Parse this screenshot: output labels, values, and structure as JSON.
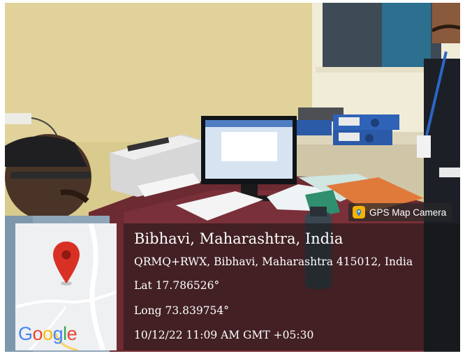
{
  "badge": {
    "label": "GPS Map Camera",
    "icon": "camera-icon"
  },
  "map": {
    "logo_text": "Google",
    "pin_icon": "map-pin-icon"
  },
  "location": {
    "title": "Bibhavi, Maharashtra, India",
    "address": "QRMQ+RWX, Bibhavi, Maharashtra 415012, India",
    "latitude": "Lat 17.786526°",
    "longitude": "Long 73.839754°",
    "timestamp": "10/12/22 11:09 AM GMT +05:30"
  },
  "colors": {
    "google_blue": "#4285F4",
    "google_red": "#EA4335",
    "google_yellow": "#FBBC05",
    "google_green": "#34A853",
    "pin_red": "#d93025",
    "badge_icon": "#f2b400"
  }
}
